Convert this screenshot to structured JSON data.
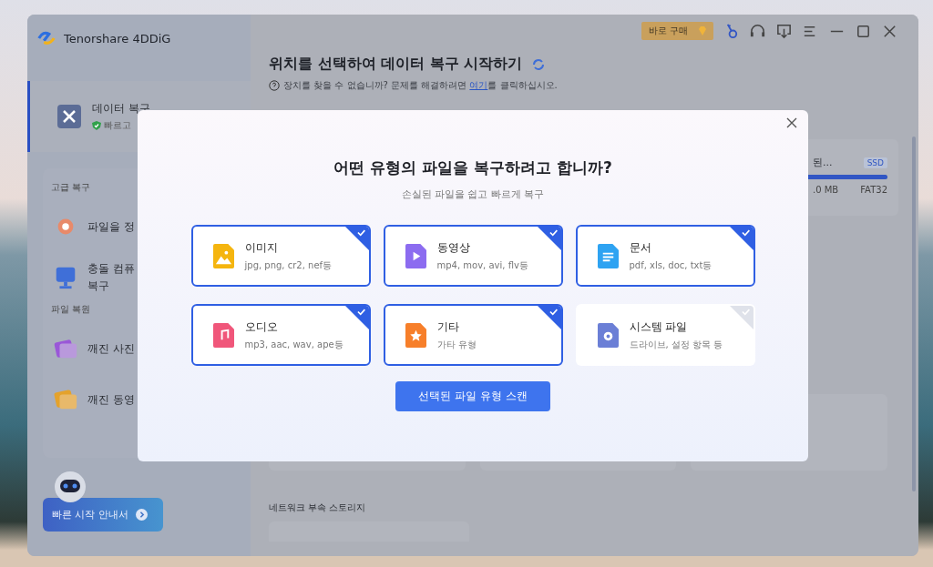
{
  "app": {
    "title": "Tenorshare 4DDiG"
  },
  "toolbar": {
    "buy_label": "바로 구매"
  },
  "sidebar": {
    "main_item": {
      "label": "데이터 복구",
      "sublabel": "빠르고",
      "selected": true
    },
    "sections": [
      {
        "title": "고급 복구",
        "items": [
          {
            "label": "파일을 정",
            "kind": "focus"
          },
          {
            "label": "충돌 컴퓨",
            "label_2": "복구",
            "kind": "pc"
          }
        ]
      },
      {
        "title": "파일 복원",
        "items": [
          {
            "label": "깨진 사진",
            "kind": "photo"
          },
          {
            "label": "깨진 동영",
            "kind": "video"
          }
        ]
      }
    ],
    "guide_button": "빠른 시작 안내서"
  },
  "main": {
    "heading": "위치를 선택하여 데이터 복구 시작하기",
    "help_text": "장치를 찾을 수 없습니까? 문제를 해결하려면 ",
    "help_link": "여기",
    "help_after": "를 클릭하십시오.",
    "drive": {
      "name": "된...",
      "badge": "SSD",
      "level": 1,
      "size": ".0 MB",
      "filesystem": "FAT32"
    },
    "network_label": "네트워크 부속 스토리지"
  },
  "dialog": {
    "title": "어떤 유형의 파일을 복구하려고 합니까?",
    "subtitle": "손실된 파일을 쉽고 빠르게 복구",
    "file_types": [
      {
        "name": "이미지",
        "extensions": "jpg, png, cr2, nef등",
        "kind": "image",
        "checked": true
      },
      {
        "name": "동영상",
        "extensions": "mp4, mov, avi, flv등",
        "kind": "video",
        "checked": true
      },
      {
        "name": "문서",
        "extensions": "pdf, xls, doc, txt등",
        "kind": "document",
        "checked": true
      },
      {
        "name": "오디오",
        "extensions": "mp3, aac, wav, ape등",
        "kind": "audio",
        "checked": true
      },
      {
        "name": "기타",
        "extensions": "가타 유형",
        "kind": "other",
        "checked": true
      },
      {
        "name": "시스템 파일",
        "extensions": "드라이브, 설정 항목 등",
        "kind": "system",
        "checked": false
      }
    ],
    "scan_button": "선택된 파일 유형 스캔"
  }
}
